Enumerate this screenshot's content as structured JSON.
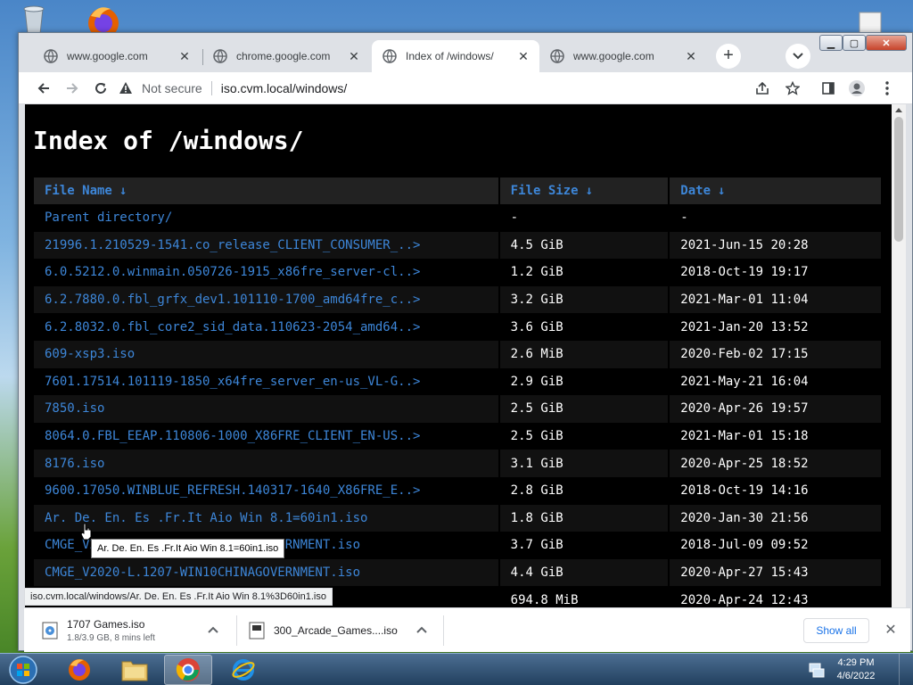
{
  "tabs": [
    {
      "label": "www.google.com",
      "active": false
    },
    {
      "label": "chrome.google.com",
      "active": false
    },
    {
      "label": "Index of /windows/",
      "active": true
    },
    {
      "label": "www.google.com",
      "active": false
    }
  ],
  "toolbar": {
    "security_label": "Not secure",
    "url": "iso.cvm.local/windows/"
  },
  "page": {
    "heading": "Index of /windows/",
    "columns": {
      "name": "File Name",
      "size": "File Size",
      "date": "Date",
      "sort_arrow": "↓"
    },
    "rows": [
      {
        "name": "Parent directory/",
        "size": "-",
        "date": "-"
      },
      {
        "name": "21996.1.210529-1541.co_release_CLIENT_CONSUMER_..>",
        "size": "4.5 GiB",
        "date": "2021-Jun-15 20:28"
      },
      {
        "name": "6.0.5212.0.winmain.050726-1915_x86fre_server-cl..>",
        "size": "1.2 GiB",
        "date": "2018-Oct-19 19:17"
      },
      {
        "name": "6.2.7880.0.fbl_grfx_dev1.101110-1700_amd64fre_c..>",
        "size": "3.2 GiB",
        "date": "2021-Mar-01 11:04"
      },
      {
        "name": "6.2.8032.0.fbl_core2_sid_data.110623-2054_amd64..>",
        "size": "3.6 GiB",
        "date": "2021-Jan-20 13:52"
      },
      {
        "name": "609-xsp3.iso",
        "size": "2.6 MiB",
        "date": "2020-Feb-02 17:15"
      },
      {
        "name": "7601.17514.101119-1850_x64fre_server_en-us_VL-G..>",
        "size": "2.9 GiB",
        "date": "2021-May-21 16:04"
      },
      {
        "name": "7850.iso",
        "size": "2.5 GiB",
        "date": "2020-Apr-26 19:57"
      },
      {
        "name": "8064.0.FBL_EEAP.110806-1000_X86FRE_CLIENT_EN-US..>",
        "size": "2.5 GiB",
        "date": "2021-Mar-01 15:18"
      },
      {
        "name": "8176.iso",
        "size": "3.1 GiB",
        "date": "2020-Apr-25 18:52"
      },
      {
        "name": "9600.17050.WINBLUE_REFRESH.140317-1640_X86FRE_E..>",
        "size": "2.8 GiB",
        "date": "2018-Oct-19 14:16"
      },
      {
        "name": "Ar. De. En. Es .Fr.It Aio Win 8.1=60in1.iso",
        "size": "1.8 GiB",
        "date": "2020-Jan-30 21:56"
      },
      {
        "name": "CMGE_V2020-L.1207-WIN10CHINAGOVERNMENT.iso",
        "size": "3.7 GiB",
        "date": "2018-Jul-09 09:52"
      },
      {
        "name": "CMGE_V2020-L.1207-WIN10CHINAGOVERNMENT.iso",
        "size": "4.4 GiB",
        "date": "2020-Apr-27 15:43"
      },
      {
        "name": "",
        "size": "694.8 MiB",
        "date": "2020-Apr-24 12:43"
      }
    ],
    "tooltip": "Ar. De. En. Es .Fr.It Aio Win 8.1=60in1.iso",
    "status_url": "iso.cvm.local/windows/Ar. De. En. Es .Fr.It Aio Win 8.1%3D60in1.iso"
  },
  "downloads": {
    "items": [
      {
        "name": "1707 Games.iso",
        "status": "1.8/3.9 GB, 8 mins left"
      },
      {
        "name": "300_Arcade_Games....iso",
        "status": ""
      }
    ],
    "show_all": "Show all"
  },
  "taskbar": {
    "time": "4:29 PM",
    "date": "4/6/2022"
  },
  "colors": {
    "link": "#3d86d8",
    "page_bg": "#000000",
    "header_bg": "#222222"
  }
}
